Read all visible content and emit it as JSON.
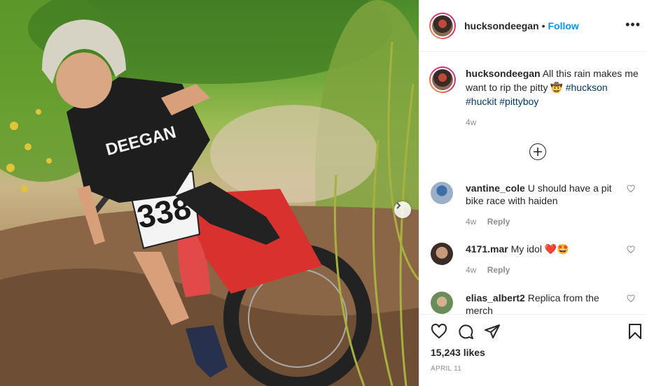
{
  "post": {
    "username": "hucksondeegan",
    "follow_label": "Follow",
    "dot": "•",
    "more_label": "•••",
    "caption_text": "All this rain makes me want to rip the pitty",
    "caption_emoji": "🤠",
    "hashtags": [
      "#huckson",
      "#huckit",
      "#pittyboy"
    ],
    "caption_age": "4w",
    "likes": "15,243 likes",
    "date": "APRIL 11"
  },
  "photo": {
    "bike_number": "338",
    "shirt_text": "DEEGAN"
  },
  "comments": [
    {
      "username": "vantine_cole",
      "text": "U should have a pit bike race with haiden",
      "age": "4w",
      "reply_label": "Reply"
    },
    {
      "username": "4171.mar",
      "text": "My idol",
      "emoji": "❤️🤩",
      "age": "4w",
      "reply_label": "Reply"
    },
    {
      "username": "elias_albert2",
      "text": "Replica from the merch"
    }
  ],
  "colors": {
    "follow": "#0095f6",
    "hashtag": "#00376b",
    "muted": "#8e8e8e"
  },
  "icons": [
    "heart-icon",
    "comment-icon",
    "share-icon",
    "bookmark-icon",
    "plus-circle-icon",
    "chevron-right-icon",
    "more-icon"
  ]
}
